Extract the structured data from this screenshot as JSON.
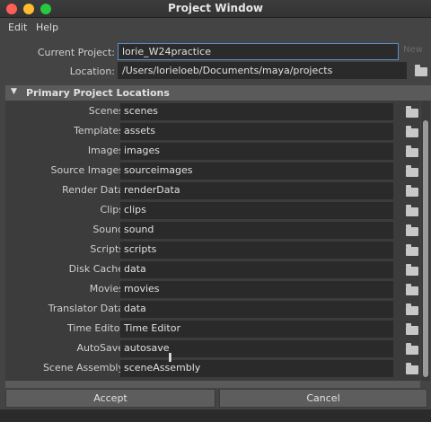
{
  "window": {
    "title": "Project Window"
  },
  "menu": {
    "items": [
      "Edit",
      "Help"
    ]
  },
  "current_project": {
    "label": "Current Project:",
    "value": "lorie_W24practice",
    "new_label": "New"
  },
  "location": {
    "label": "Location:",
    "value": "/Users/lorieloeb/Documents/maya/projects"
  },
  "primary_section": {
    "title": "Primary Project Locations"
  },
  "primary_locations": [
    {
      "label": "Scenes",
      "value": "scenes"
    },
    {
      "label": "Templates",
      "value": "assets"
    },
    {
      "label": "Images",
      "value": "images"
    },
    {
      "label": "Source Images",
      "value": "sourceimages"
    },
    {
      "label": "Render Data",
      "value": "renderData"
    },
    {
      "label": "Clips",
      "value": "clips"
    },
    {
      "label": "Sound",
      "value": "sound"
    },
    {
      "label": "Scripts",
      "value": "scripts"
    },
    {
      "label": "Disk Cache",
      "value": "data"
    },
    {
      "label": "Movies",
      "value": "movies"
    },
    {
      "label": "Translator Data",
      "value": "data"
    },
    {
      "label": "Time Editor",
      "value": "Time Editor"
    },
    {
      "label": "AutoSave",
      "value": "autosave"
    },
    {
      "label": "Scene Assembly",
      "value": "sceneAssembly"
    }
  ],
  "buttons": {
    "accept": "Accept",
    "cancel": "Cancel"
  },
  "colors": {
    "active_border": "#5a8fc8",
    "field_bg": "#2a2a2a",
    "panel_bg": "#444444"
  },
  "icons": [
    "folder-icon",
    "triangle-down-icon"
  ]
}
